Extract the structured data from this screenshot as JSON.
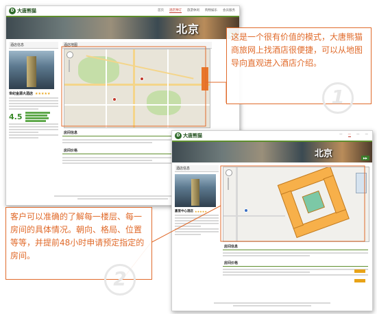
{
  "panel1": {
    "logo_text": "大唐熊猫",
    "nav": [
      "首页",
      "酒店预订",
      "旅游休闲",
      "购物娱乐",
      "会员服务"
    ],
    "active_nav_index": 1,
    "banner_city": "北京",
    "sections": {
      "hotel_info": "酒店信息",
      "map": "酒店地图",
      "rooms": "房间信息",
      "prices": "房间价格"
    },
    "hotel_name": "世纪金源大酒店",
    "score": "4.5"
  },
  "panel2": {
    "logo_text": "大唐熊猫",
    "banner_city": "北京",
    "sections": {
      "hotel_info": "酒店信息",
      "rooms": "房间信息",
      "prices": "房间价格"
    },
    "hotel_name": "嘉里中心酒店"
  },
  "callouts": {
    "first": "这是一个很有价值的模式，大唐熊猫商旅网上找酒店很便捷，可以从地图导向直观进入酒店介绍。",
    "second": "客户可以准确的了解每一楼层、每一房间的具体情况。朝向、格局、位置等等，并提前48小时申请预定指定的房间。",
    "first_number": "1",
    "second_number": "2"
  },
  "colors": {
    "accent": "#e06a2a",
    "brand_green": "#3a7d2b"
  }
}
